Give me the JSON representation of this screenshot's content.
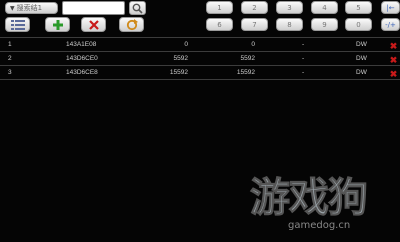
{
  "toolbar": {
    "dropdown_label": "搜索结1",
    "search_value": "",
    "list_icon": "list-icon",
    "add_icon": "plus-icon",
    "delete_icon": "close-icon",
    "refresh_icon": "refresh-icon",
    "search_icon": "magnifier-icon"
  },
  "keypad": {
    "row1": [
      "1",
      "2",
      "3",
      "4",
      "5",
      "|←"
    ],
    "row2": [
      "6",
      "7",
      "8",
      "9",
      "0",
      "-/+"
    ]
  },
  "table": {
    "rows": [
      {
        "index": "1",
        "address": "143A1E08",
        "value": "0",
        "value2": "0",
        "dash": "-",
        "type": "DW"
      },
      {
        "index": "2",
        "address": "143D6CE0",
        "value": "5592",
        "value2": "5592",
        "dash": "-",
        "type": "DW"
      },
      {
        "index": "3",
        "address": "143D6CE8",
        "value": "15592",
        "value2": "15592",
        "dash": "-",
        "type": "DW"
      }
    ]
  },
  "watermark": {
    "title": "游戏狗",
    "url": "gamedog.cn"
  },
  "colors": {
    "background": "#050505",
    "delete_red": "#c81a1a",
    "add_green": "#2a9a2a"
  }
}
